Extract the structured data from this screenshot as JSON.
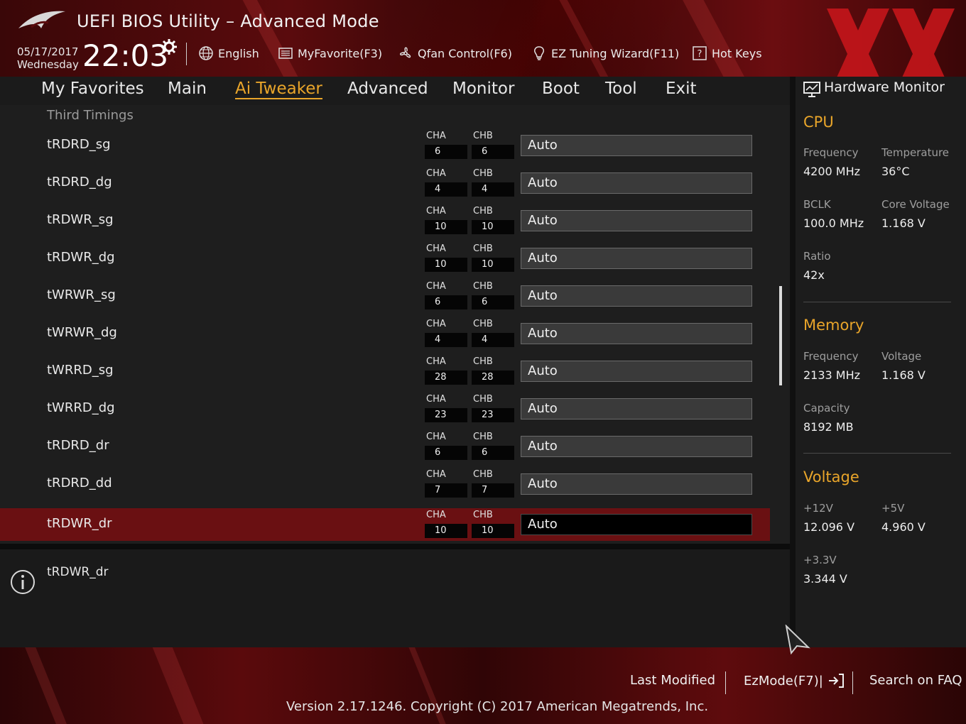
{
  "header": {
    "title": "UEFI BIOS Utility – Advanced Mode",
    "date": "05/17/2017",
    "weekday": "Wednesday",
    "time": "22:03",
    "buttons": {
      "language": "English",
      "favorite": "MyFavorite(F3)",
      "qfan": "Qfan Control(F6)",
      "ez_tuning": "EZ Tuning Wizard(F11)",
      "hotkeys": "Hot Keys"
    }
  },
  "nav": {
    "tabs": [
      {
        "label": "My Favorites"
      },
      {
        "label": "Main"
      },
      {
        "label": "Ai Tweaker"
      },
      {
        "label": "Advanced"
      },
      {
        "label": "Monitor"
      },
      {
        "label": "Boot"
      },
      {
        "label": "Tool"
      },
      {
        "label": "Exit"
      }
    ],
    "active": "Ai Tweaker"
  },
  "main": {
    "section_title": "Third Timings",
    "channel_a": "CHA",
    "channel_b": "CHB",
    "rows": [
      {
        "label": "tRDRD_sg",
        "cha": "6",
        "chb": "6",
        "value": "Auto"
      },
      {
        "label": "tRDRD_dg",
        "cha": "4",
        "chb": "4",
        "value": "Auto"
      },
      {
        "label": "tRDWR_sg",
        "cha": "10",
        "chb": "10",
        "value": "Auto"
      },
      {
        "label": "tRDWR_dg",
        "cha": "10",
        "chb": "10",
        "value": "Auto"
      },
      {
        "label": "tWRWR_sg",
        "cha": "6",
        "chb": "6",
        "value": "Auto"
      },
      {
        "label": "tWRWR_dg",
        "cha": "4",
        "chb": "4",
        "value": "Auto"
      },
      {
        "label": "tWRRD_sg",
        "cha": "28",
        "chb": "28",
        "value": "Auto"
      },
      {
        "label": "tWRRD_dg",
        "cha": "23",
        "chb": "23",
        "value": "Auto"
      },
      {
        "label": "tRDRD_dr",
        "cha": "6",
        "chb": "6",
        "value": "Auto"
      },
      {
        "label": "tRDRD_dd",
        "cha": "7",
        "chb": "7",
        "value": "Auto"
      },
      {
        "label": "tRDWR_dr",
        "cha": "10",
        "chb": "10",
        "value": "Auto"
      }
    ],
    "selected_row": "tRDWR_dr"
  },
  "info": {
    "text": "tRDWR_dr"
  },
  "hardware_monitor": {
    "title": "Hardware Monitor",
    "cpu": {
      "heading": "CPU",
      "frequency_label": "Frequency",
      "frequency": "4200 MHz",
      "temperature_label": "Temperature",
      "temperature": "36°C",
      "bclk_label": "BCLK",
      "bclk": "100.0 MHz",
      "core_voltage_label": "Core Voltage",
      "core_voltage": "1.168 V",
      "ratio_label": "Ratio",
      "ratio": "42x"
    },
    "memory": {
      "heading": "Memory",
      "frequency_label": "Frequency",
      "frequency": "2133 MHz",
      "voltage_label": "Voltage",
      "voltage": "1.168 V",
      "capacity_label": "Capacity",
      "capacity": "8192 MB"
    },
    "voltage": {
      "heading": "Voltage",
      "v12_label": "+12V",
      "v12": "12.096 V",
      "v5_label": "+5V",
      "v5": "4.960 V",
      "v33_label": "+3.3V",
      "v33": "3.344 V"
    }
  },
  "footer": {
    "last_modified": "Last Modified",
    "ezmode": "EzMode(F7)|",
    "search_faq": "Search on FAQ",
    "version": "Version 2.17.1246. Copyright (C) 2017 American Megatrends, Inc."
  },
  "colors": {
    "accent": "#e9a52a",
    "selected_row": "#6a1012",
    "brand_red": "#5a0b0d"
  }
}
